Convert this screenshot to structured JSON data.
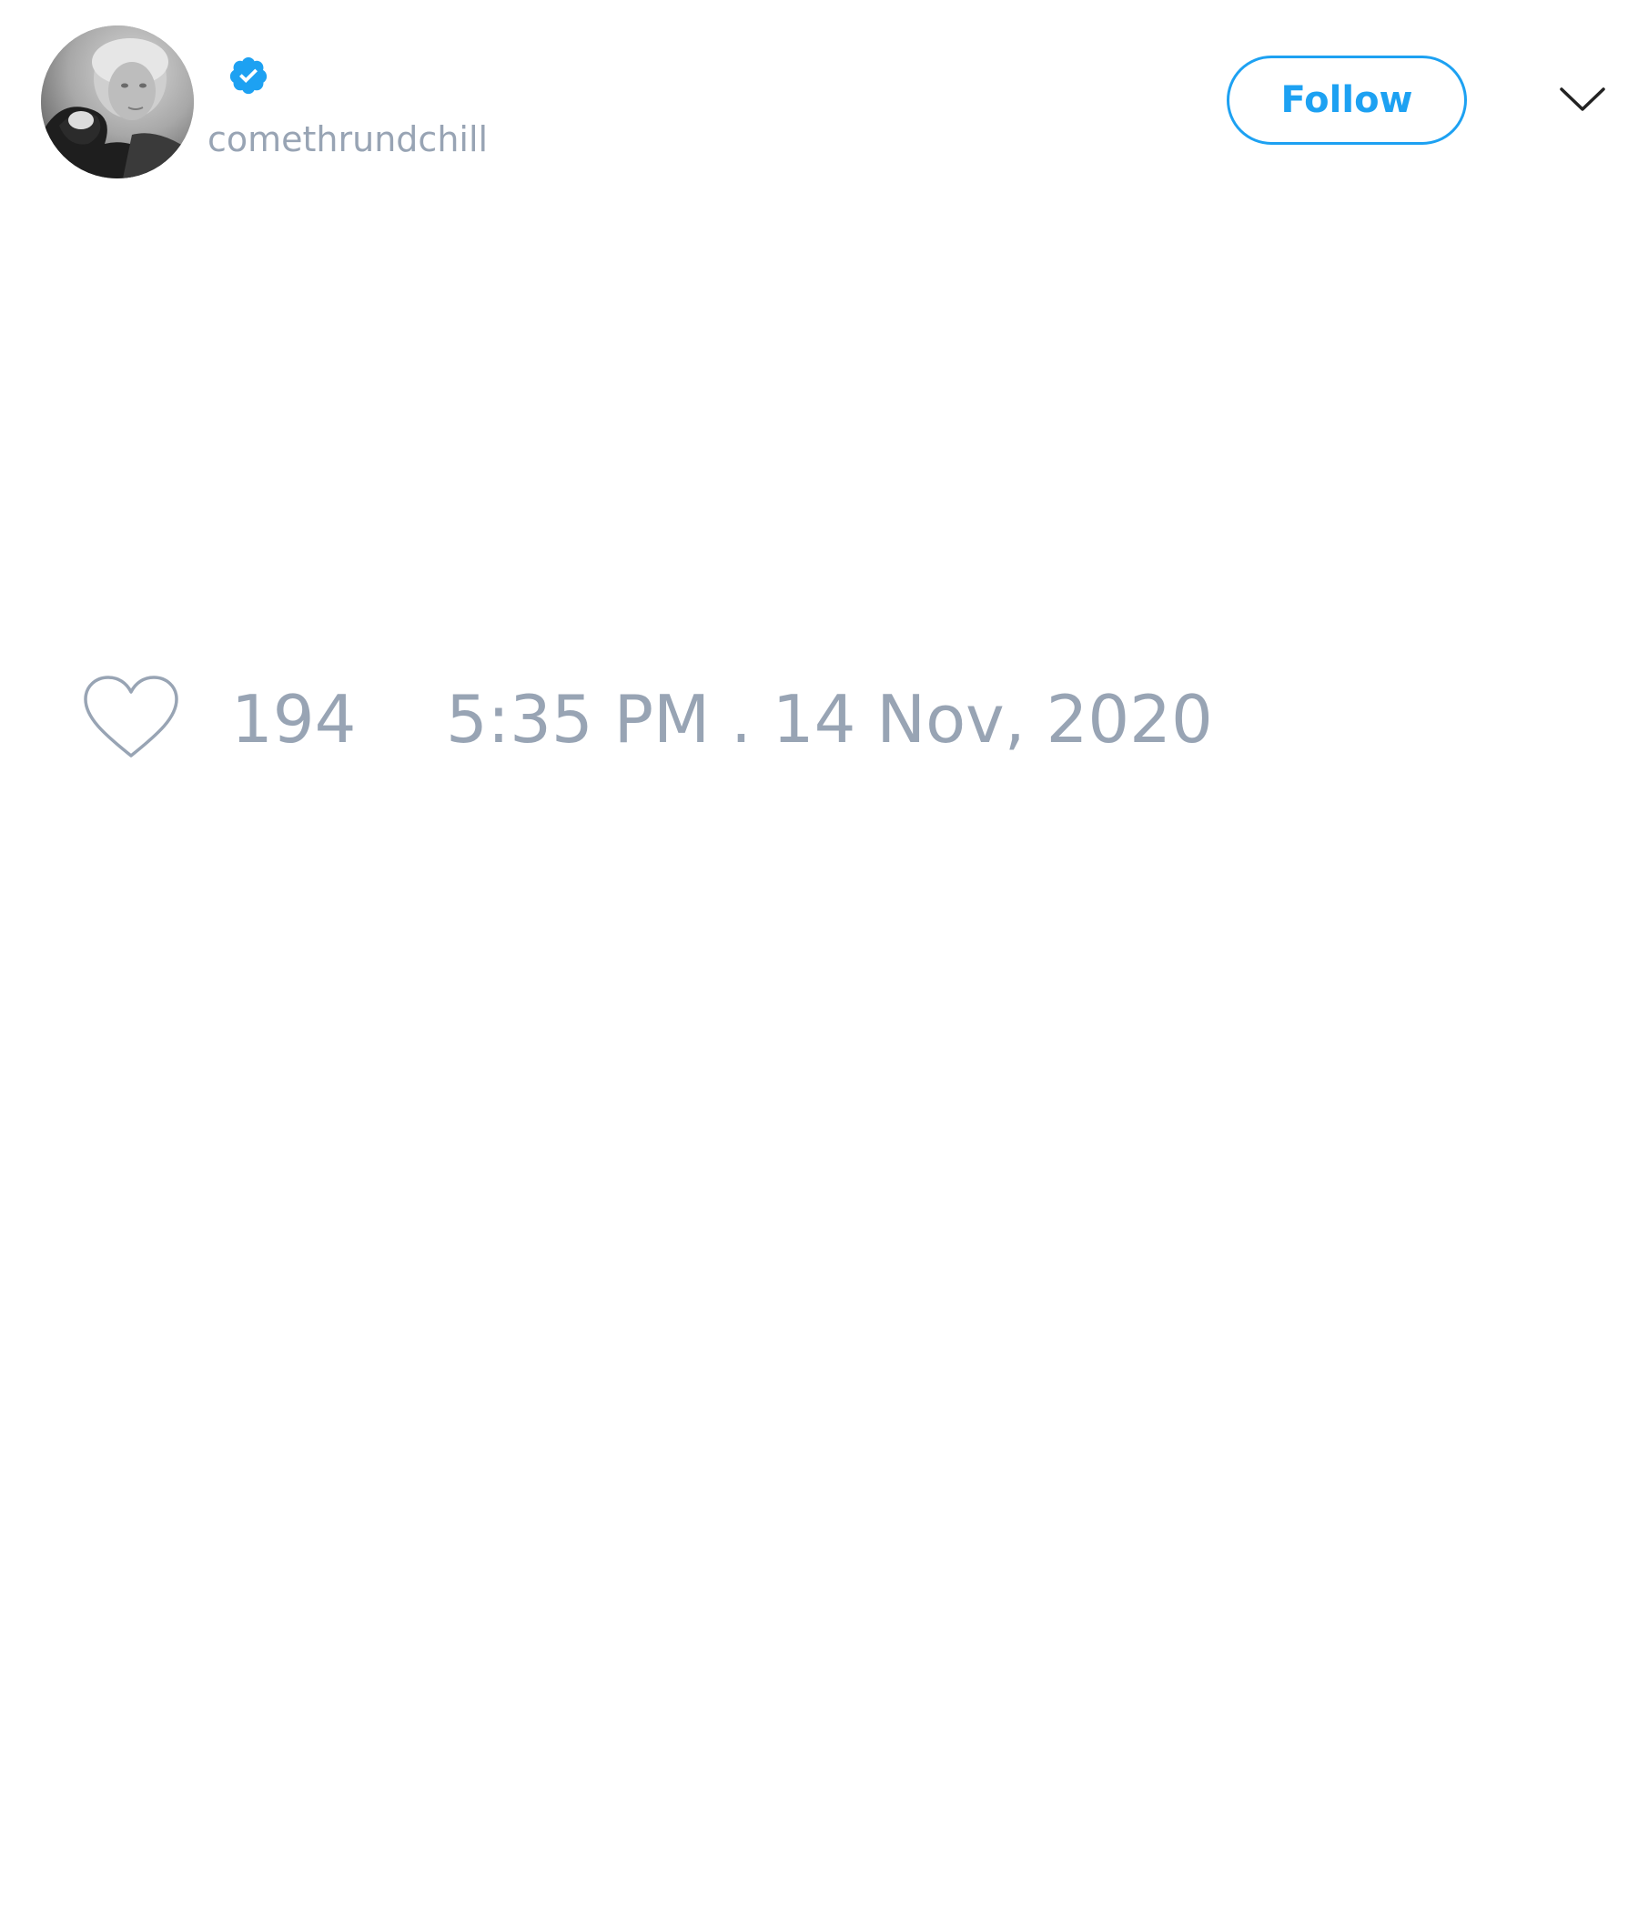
{
  "tweet": {
    "author": {
      "handle": "comethrundchill",
      "avatar_icon": "profile-photo-icon",
      "verified": true,
      "verified_icon": "verified-badge-icon"
    },
    "follow_label": "Follow",
    "menu_icon": "chevron-down-icon",
    "likes": {
      "icon": "heart-icon",
      "count": "194"
    },
    "timestamp": "5:35 PM . 14 Nov, 2020"
  },
  "colors": {
    "accent": "#1da1f2",
    "muted_text": "#98a4b4",
    "background": "#ffffff"
  }
}
